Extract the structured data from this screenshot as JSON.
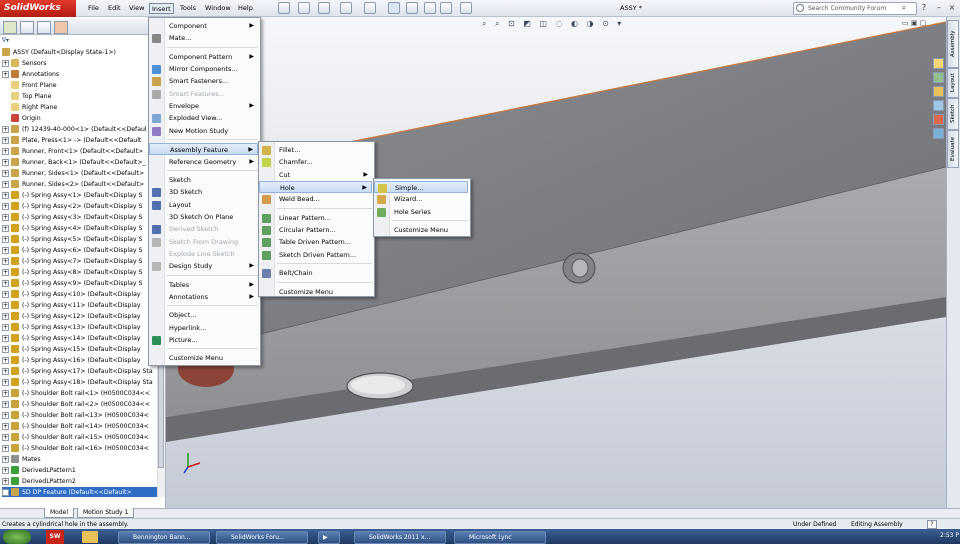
{
  "app": {
    "logo": "SolidWorks",
    "doc_title": "ASSY *"
  },
  "menubar": [
    "File",
    "Edit",
    "View",
    "Insert",
    "Tools",
    "Window",
    "Help"
  ],
  "search": {
    "placeholder": "Search Community Forum"
  },
  "tree": {
    "filter_label": "∇▾",
    "root": "ASSY  (Default<Display State-1>)",
    "items": [
      "Sensors",
      "Annotations",
      "Front Plane",
      "Top Plane",
      "Right Plane",
      "Origin",
      "(f) 12439-40-000<1> (Default<<Defaul",
      "Plate, Press<1> -> (Default<<Default",
      "Runner, Front<1> (Default<<Default>",
      "Runner, Back<1> (Default<<Default>_",
      "Runner, Sides<1> (Default<<Default>",
      "Runner, Sides<2> (Default<<Default>",
      "(-) Spring Assy<1> (Default<Display S",
      "(-) Spring Assy<2> (Default<Display S",
      "(-) Spring Assy<3> (Default<Display S",
      "(-) Spring Assy<4> (Default<Display S",
      "(-) Spring Assy<5> (Default<Display S",
      "(-) Spring Assy<6> (Default<Display S",
      "(-) Spring Assy<7> (Default<Display S",
      "(-) Spring Assy<8> (Default<Display S",
      "(-) Spring Assy<9> (Default<Display S",
      "(-) Spring Assy<10> (Default<Display",
      "(-) Spring Assy<11> (Default<Display",
      "(-) Spring Assy<12> (Default<Display",
      "(-) Spring Assy<13> (Default<Display",
      "(-) Spring Assy<14> (Default<Display",
      "(-) Spring Assy<15> (Default<Display",
      "(-) Spring Assy<16> (Default<Display",
      "(-) Spring Assy<17> (Default<Display Sta",
      "(-) Spring Assy<18> (Default<Display Sta",
      "(-) Shoulder Bolt rail<1> (H0500C034<<",
      "(-) Shoulder Bolt rail<2> (H0500C034<<",
      "(-) Shoulder Bolt rail<13> (H0500C034<",
      "(-) Shoulder Bolt rail<14> (H0500C034<",
      "(-) Shoulder Bolt rail<15> (H0500C034<",
      "(-) Shoulder Bolt rail<16> (H0500C034<",
      "Mates",
      "DerivedLPattern1",
      "DerivedLPattern2",
      "SD DP Feature (Default<<Default>"
    ]
  },
  "insert_menu": [
    {
      "label": "Component",
      "arrow": true
    },
    {
      "label": "Mate..."
    },
    {
      "sep": true
    },
    {
      "label": "Component Pattern",
      "arrow": true
    },
    {
      "label": "Mirror Components..."
    },
    {
      "label": "Smart Fasteners..."
    },
    {
      "label": "Smart Features...",
      "disabled": true
    },
    {
      "label": "Envelope",
      "arrow": true
    },
    {
      "label": "Exploded View..."
    },
    {
      "label": "New Motion Study"
    },
    {
      "sep": true
    },
    {
      "label": "Assembly Feature",
      "arrow": true,
      "hi": true
    },
    {
      "label": "Reference Geometry",
      "arrow": true
    },
    {
      "sep": true
    },
    {
      "label": "Sketch"
    },
    {
      "label": "3D Sketch"
    },
    {
      "label": "Layout"
    },
    {
      "label": "3D Sketch On Plane"
    },
    {
      "label": "Derived Sketch",
      "disabled": true
    },
    {
      "label": "Sketch From Drawing",
      "disabled": true
    },
    {
      "label": "Explode Line Sketch",
      "disabled": true
    },
    {
      "label": "Design Study",
      "arrow": true
    },
    {
      "sep": true
    },
    {
      "label": "Tables",
      "arrow": true
    },
    {
      "label": "Annotations",
      "arrow": true
    },
    {
      "sep": true
    },
    {
      "label": "Object..."
    },
    {
      "label": "Hyperlink..."
    },
    {
      "label": "Picture..."
    },
    {
      "sep": true
    },
    {
      "label": "Customize Menu"
    }
  ],
  "feature_menu": [
    {
      "label": "Fillet..."
    },
    {
      "label": "Chamfer..."
    },
    {
      "label": "Cut",
      "arrow": true
    },
    {
      "label": "Hole",
      "arrow": true,
      "hi": true
    },
    {
      "label": "Weld Bead..."
    },
    {
      "sep": true
    },
    {
      "label": "Linear Pattern..."
    },
    {
      "label": "Circular Pattern..."
    },
    {
      "label": "Table Driven Pattern..."
    },
    {
      "label": "Sketch Driven Pattern..."
    },
    {
      "sep": true
    },
    {
      "label": "Belt/Chain"
    },
    {
      "sep": true
    },
    {
      "label": "Customize Menu"
    }
  ],
  "hole_menu": [
    {
      "label": "Simple...",
      "hi": true
    },
    {
      "label": "Wizard..."
    },
    {
      "label": "Hole Series"
    },
    {
      "sep": true
    },
    {
      "label": "Customize Menu"
    }
  ],
  "bottom_tabs": [
    "Model",
    "Motion Study 1"
  ],
  "status": {
    "message": "Creates a cylindrical hole in the assembly.",
    "right1": "Under Defined",
    "right2": "Editing Assembly",
    "help": "?"
  },
  "task_pane_tabs": [
    "Assembly",
    "Layout",
    "Sketch",
    "Evaluate"
  ],
  "taskbar": {
    "items": [
      "Bennington Bann...",
      "SolidWorks Foru...",
      "",
      "SolidWorks 2011 x...",
      "Microsoft Lync"
    ],
    "clock": "2:53 P"
  }
}
